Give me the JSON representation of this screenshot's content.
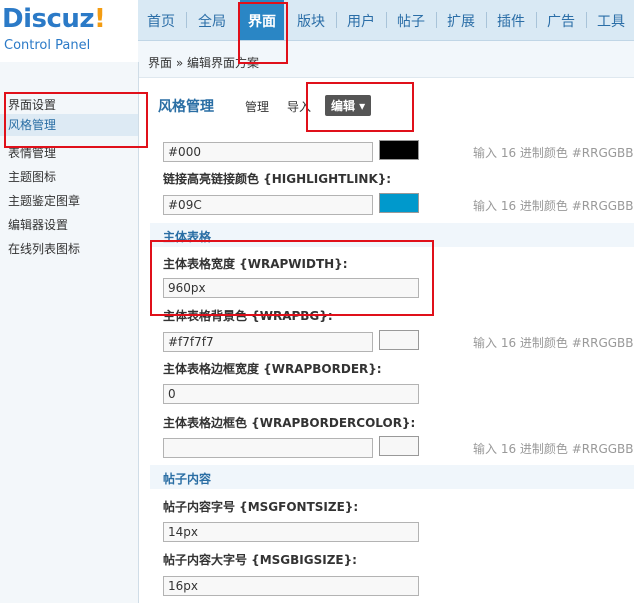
{
  "logo": {
    "brand": "Discuz",
    "brand_bang": "!",
    "subtitle": "Control Panel"
  },
  "topnav": [
    "首页",
    "全局",
    "界面",
    "版块",
    "用户",
    "帖子",
    "扩展",
    "插件",
    "广告",
    "工具"
  ],
  "topnav_active": "界面",
  "breadcrumb": "界面 » 编辑界面方案",
  "sidebar": [
    "界面设置",
    "风格管理",
    "表情管理",
    "主题图标",
    "主题鉴定图章",
    "编辑器设置",
    "在线列表图标"
  ],
  "sidebar_active": "风格管理",
  "section_title": "风格管理",
  "tabs": {
    "manage": "管理",
    "import": "导入",
    "edit": "编辑 ▾"
  },
  "hint_text": "输入 16 进制颜色 #RRGGBB",
  "fields": {
    "top": {
      "value": "#000",
      "swatch": "#000000"
    },
    "highlightlink": {
      "label": "链接高亮链接颜色 {HIGHLIGHTLINK}:",
      "value": "#09C",
      "swatch": "#0099cc"
    },
    "wrap_group": "主体表格",
    "wrapwidth": {
      "label": "主体表格宽度 {WRAPWIDTH}:",
      "value": "960px"
    },
    "wrapbg": {
      "label": "主体表格背景色 {WRAPBG}:",
      "value": "#f7f7f7",
      "swatch": "#f7f7f7"
    },
    "wrapborder": {
      "label": "主体表格边框宽度 {WRAPBORDER}:",
      "value": "0"
    },
    "wrapbordercolor": {
      "label": "主体表格边框色 {WRAPBORDERCOLOR}:",
      "value": "",
      "swatch": "#f7f7f7"
    },
    "msg_group": "帖子内容",
    "msgfontsize": {
      "label": "帖子内容字号 {MSGFONTSIZE}:",
      "value": "14px"
    },
    "msgbigsize": {
      "label": "帖子内容大字号 {MSGBIGSIZE}:",
      "value": "16px"
    }
  },
  "colors": {
    "accent": "#2a86c5",
    "highlight": "#e0101a"
  }
}
